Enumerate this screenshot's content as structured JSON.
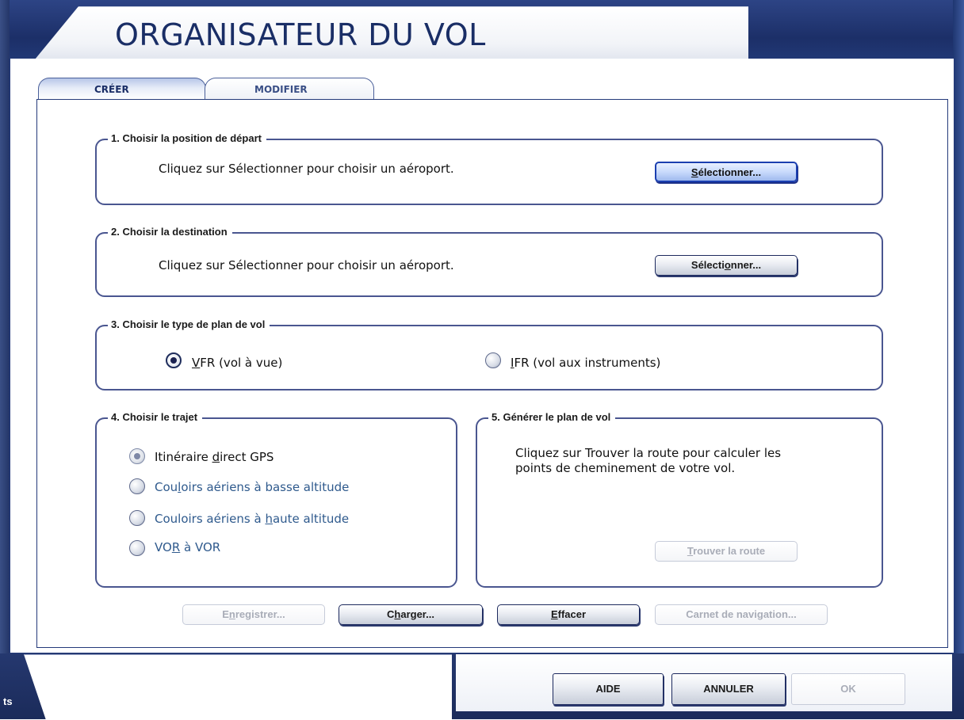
{
  "window": {
    "title": "ORGANISATEUR DU VOL"
  },
  "tabs": [
    {
      "label": "CRÉER",
      "active": true
    },
    {
      "label": "MODIFIER",
      "active": false
    }
  ],
  "section1": {
    "title": "1. Choisir la position de départ",
    "note": "Cliquez sur Sélectionner pour choisir un aéroport.",
    "button": {
      "pre": "",
      "u": "S",
      "post": "électionner...",
      "state": "active"
    }
  },
  "section2": {
    "title": "2. Choisir la destination",
    "note": "Cliquez sur Sélectionner pour choisir un aéroport.",
    "button": {
      "pre": "Sélecti",
      "u": "o",
      "post": "nner...",
      "state": "normal"
    }
  },
  "section3": {
    "title": "3. Choisir le type de plan de vol",
    "options": [
      {
        "pre": "",
        "u": "V",
        "post": "FR (vol à vue)",
        "selected": true
      },
      {
        "pre": "",
        "u": "I",
        "post": "FR (vol aux instruments)",
        "selected": false
      }
    ]
  },
  "section4": {
    "title": "4. Choisir le trajet",
    "options": [
      {
        "pre": "Itinéraire ",
        "u": "d",
        "post": "irect GPS",
        "selected": true,
        "enabled": false
      },
      {
        "pre": "Cou",
        "u": "l",
        "post": "oirs aériens à basse altitude",
        "selected": false
      },
      {
        "pre": "Couloirs aériens à ",
        "u": "h",
        "post": "aute altitude",
        "selected": false
      },
      {
        "pre": "VO",
        "u": "R",
        "post": " à VOR",
        "selected": false
      }
    ]
  },
  "section5": {
    "title": "5. Générer le plan de vol",
    "note_line1": "Cliquez sur Trouver la route pour calculer les",
    "note_line2": "points de cheminement de votre vol.",
    "button": {
      "pre": "",
      "u": "T",
      "post": "rouver la route",
      "state": "disabled"
    }
  },
  "actions": [
    {
      "pre": "E",
      "u": "n",
      "post": "registrer...",
      "state": "disabled"
    },
    {
      "pre": "C",
      "u": "h",
      "post": "arger...",
      "state": "normal"
    },
    {
      "pre": "",
      "u": "E",
      "post": "ffacer",
      "state": "normal"
    },
    {
      "pre": "Carnet de navi",
      "u": "g",
      "post": "ation...",
      "state": "disabled"
    }
  ],
  "footer": {
    "aide": "AIDE",
    "annuler": "ANNULER",
    "ok": "OK",
    "side_text": "ts"
  },
  "colors": {
    "frame": "#1c2f68",
    "group_border": "#4a5690",
    "option_text_blue": "#2f5a8d",
    "active_button": "#c9dafc"
  }
}
